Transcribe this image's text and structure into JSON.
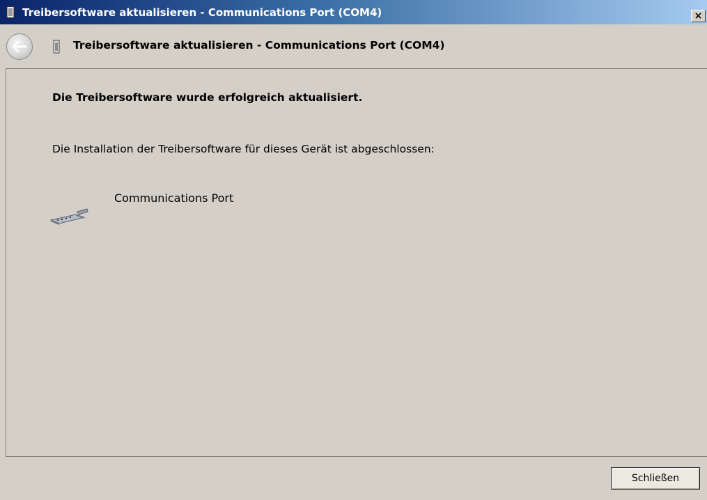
{
  "window": {
    "title": "Treibersoftware aktualisieren - Communications Port (COM4)",
    "close_glyph": "×"
  },
  "header": {
    "title": "Treibersoftware aktualisieren - Communications Port (COM4)"
  },
  "content": {
    "heading": "Die Treibersoftware wurde erfolgreich aktualisiert.",
    "message": "Die Installation der Treibersoftware für dieses Gerät ist abgeschlossen:",
    "device_name": "Communications Port"
  },
  "footer": {
    "close_label": "Schließen"
  },
  "icons": {
    "window_icon": "device-icon",
    "back": "back-arrow-icon",
    "header_icon": "device-icon",
    "device": "serial-port-icon"
  }
}
